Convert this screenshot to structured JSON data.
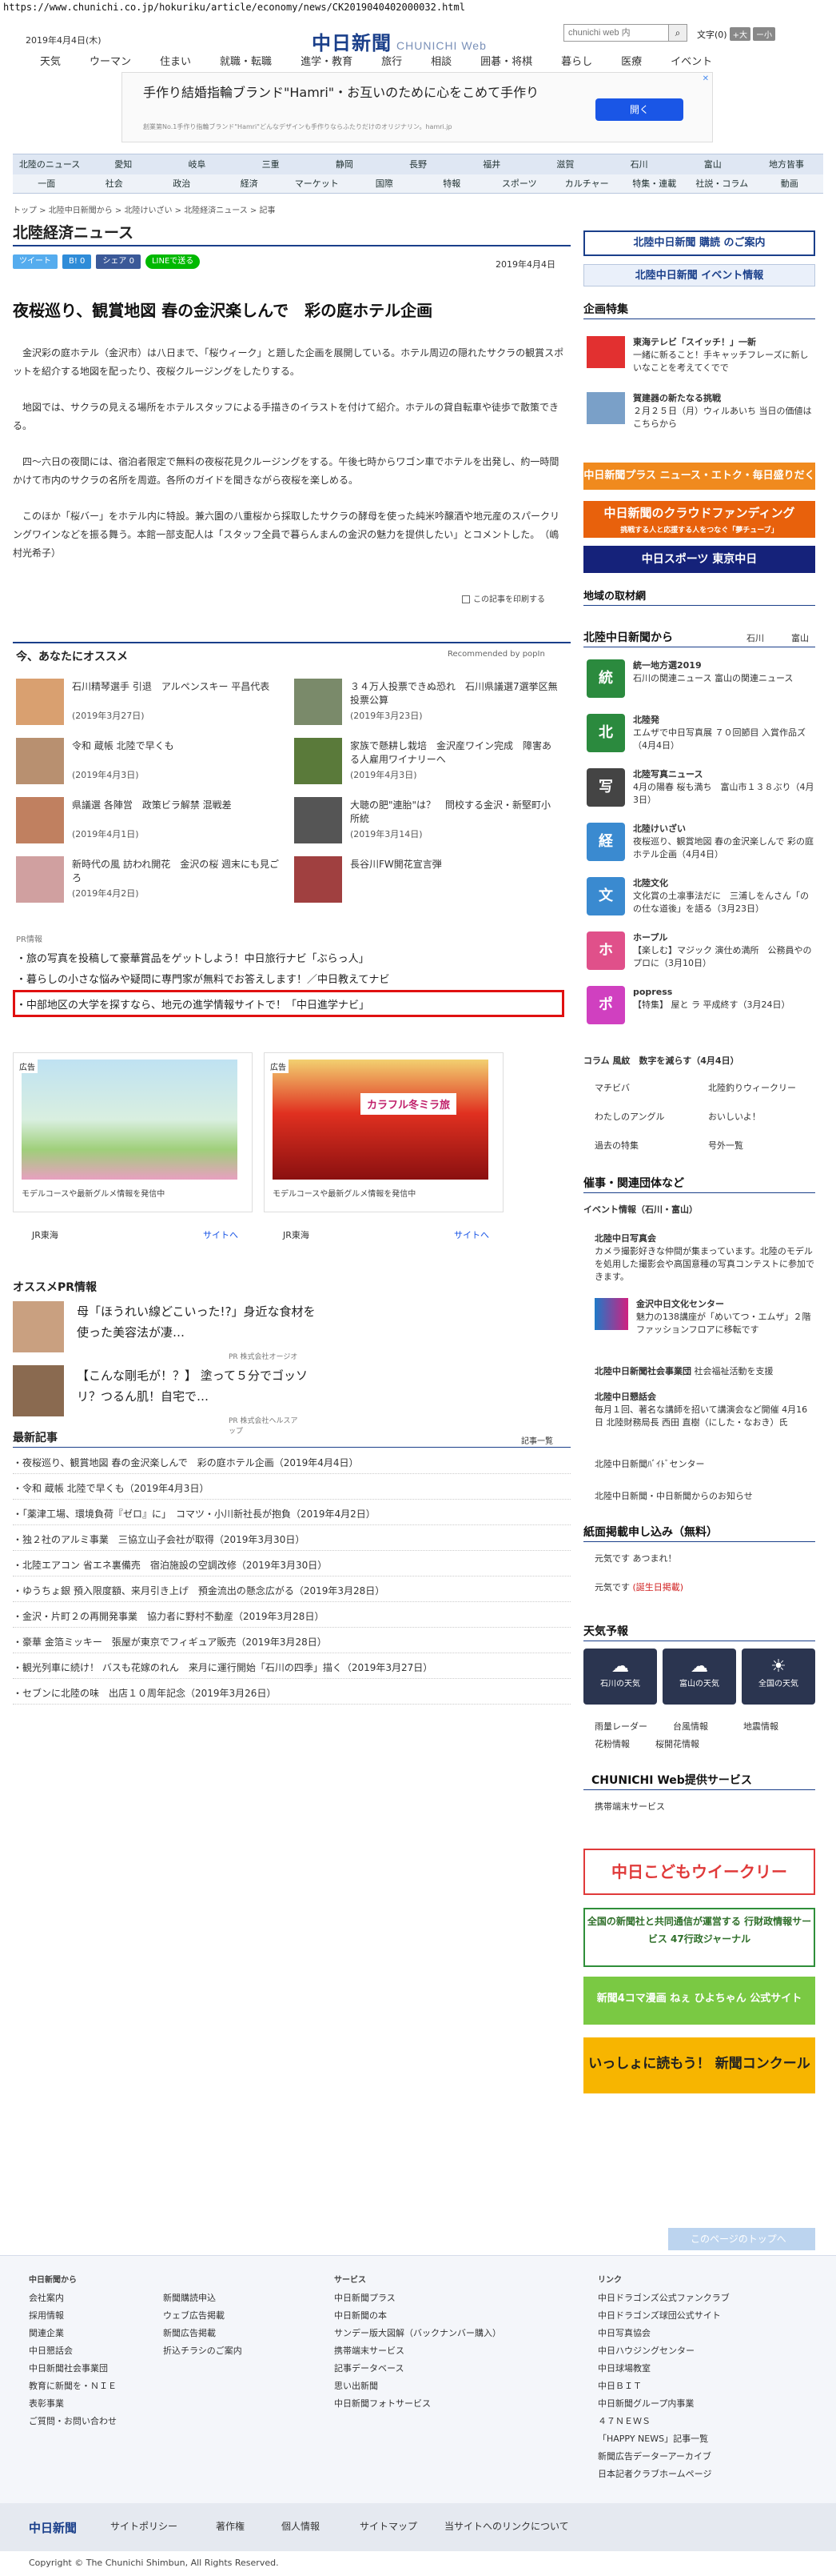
{
  "browser": {
    "url": "https://www.chunichi.co.jp/hokuriku/article/economy/news/CK2019040402000032.html"
  },
  "header": {
    "date": "2019年4月4日(木)",
    "logo": "中日新聞",
    "logo_web": "CHUNICHI Web",
    "search_placeholder": "chunichi web 内",
    "font_label": "文字",
    "font_large": "+大",
    "font_small": "ー小",
    "nav": [
      "天気",
      "ウーマン",
      "住まい",
      "就職・転職",
      "進学・教育",
      "旅行",
      "相談",
      "囲碁・将棋",
      "暮らし",
      "医療",
      "イベント"
    ]
  },
  "ad": {
    "text": "手作り結婚指輪ブランド\"Hamri\"・お互いのために心をこめて手作り",
    "sub": "創業第No.1手作り指輪ブランド\"Hamri\"どんなデザインも手作りならふたりだけのオリジナリン。hamri.jp",
    "button": "開く",
    "close": "✕"
  },
  "nav1": [
    "北陸のニュース",
    "愛知",
    "岐阜",
    "三重",
    "静岡",
    "長野",
    "福井",
    "滋賀",
    "石川",
    "富山",
    "地方皆事"
  ],
  "nav2": [
    "一面",
    "社会",
    "政治",
    "経済",
    "マーケット",
    "国際",
    "特報",
    "スポーツ",
    "カルチャー",
    "特集・連載",
    "社説・コラム",
    "動画"
  ],
  "breadcrumb": "トップ > 北陸中日新聞から > 北陸けいざい > 北陸経済ニュース > 記事",
  "section_title": "北陸経済ニュース",
  "share": {
    "tweet": "ツイート",
    "hatena": "B!  0",
    "facebook": "シェア 0",
    "line": "LINEで送る"
  },
  "article": {
    "date": "2019年4月4日",
    "title": "夜桜巡り、観賞地図 春の金沢楽しんで　彩の庭ホテル企画",
    "paragraphs": [
      "　金沢彩の庭ホテル（金沢市）は八日まで、「桜ウィーク」と題した企画を展開している。ホテル周辺の隠れたサクラの観賞スポットを紹介する地図を配ったり、夜桜クルージングをしたりする。",
      "　地図では、サクラの見える場所をホテルスタッフによる手描きのイラストを付けて紹介。ホテルの貸自転車や徒歩で散策できる。",
      "　四～六日の夜間には、宿泊者限定で無料の夜桜花見クルージングをする。午後七時からワゴン車でホテルを出発し、約一時間かけて市内のサクラの名所を周遊。各所のガイドを聞きながら夜桜を楽しめる。",
      "　このほか「桜バー」をホテル内に特設。兼六園の八重桜から採取したサクラの酵母を使った純米吟醸酒や地元産のスパークリングワインなどを振る舞う。本館一部支配人は「スタッフ全員で暮らんまんの金沢の魅力を提供したい」とコメントした。　（嶋村光希子）"
    ],
    "print": "この記事を印刷する"
  },
  "recommend": {
    "title": "今、あなたにオススメ",
    "by": "Recommended by popIn",
    "items": [
      {
        "title": "石川精琴選手 引退　アルペンスキー 平昌代表",
        "date": "(2019年3月27日)"
      },
      {
        "title": "３４万人投票できぬ恐れ　石川県議選7選挙区無投票公算",
        "date": "(2019年3月23日)"
      },
      {
        "title": "令和 蔵帳 北陸で早くも",
        "date": "(2019年4月3日)"
      },
      {
        "title": "家族で懸耕し栽培　金沢産ワイン完成　障害ある人雇用ワイナリーへ",
        "date": "(2019年4月3日)"
      },
      {
        "title": "県議選 各陣営　政策ビラ解禁 混戦差",
        "date": "(2019年4月1日)"
      },
      {
        "title": "大聴の肥\"連胎\"は？　問校する金沢・新堅町小所統",
        "date": "(2019年3月14日)"
      },
      {
        "title": "新時代の風 訪われ開花　金沢の桜 週末にも見ごろ",
        "date": "(2019年4月2日)"
      },
      {
        "title": "長谷川FW開花宣言弾",
        "date": ""
      }
    ]
  },
  "pr": {
    "label": "PR情報",
    "items": [
      "・旅の写真を投稿して豪華賞品をゲットしよう！中日旅行ナビ「ぶらっ人」",
      "・暮らしの小さな悩みや疑問に専門家が無料でお答えします！／中日教えてナビ",
      "・中部地区の大学を探すなら、地元の進学情報サイトで！「中日進学ナビ」"
    ]
  },
  "adcards": [
    {
      "label": "広告",
      "caption": "モデルコースや最新グルメ情報を発信中",
      "source": "JR東海",
      "link": "サイトへ"
    },
    {
      "label": "広告",
      "caption": "モデルコースや最新グルメ情報を発信中",
      "source": "JR東海",
      "link": "サイトへ",
      "img_text": "カラフル冬ミラ旅"
    }
  ],
  "osusume": {
    "title": "オススメPR情報",
    "items": [
      {
        "title": "母「ほうれい線どこいった!?」身近な食材を使った美容法が凄…",
        "source": "PR 株式会社オージオ"
      },
      {
        "title": "【こんな剛毛が！？】 塗って５分でゴッソリ？つるん肌！自宅で…",
        "source": "PR 株式会社ヘルスアップ"
      }
    ]
  },
  "latest": {
    "title": "最新記事",
    "more": "記事一覧",
    "items": [
      "・夜桜巡り、観賞地図 春の金沢楽しんで　彩の庭ホテル企画（2019年4月4日）",
      "・令和 蔵帳 北陸で早くも（2019年4月3日）",
      "・「薬津工場、環境負荷『ゼロ』に」　コマツ・小川新社長が抱負（2019年4月2日）",
      "・独２社のアルミ事業　三協立山子会社が取得（2019年3月30日）",
      "・北陸エアコン 省エネ裏備売　宿泊施設の空調改修（2019年3月30日）",
      "・ゆうちょ銀 預入限度額、来月引き上げ　預金流出の懸念広がる（2019年3月28日）",
      "・金沢・片町２の再開発事業　協力者に野村不動産（2019年3月28日）",
      "・豪華 金箔ミッキー　張屋が東京でフィギュア販売（2019年3月28日）",
      "・観光列車に続け！ バスも花嫁のれん　来月に運行開始「石川の四季」描く（2019年3月27日）",
      "・セブンに北陸の味　出店１０周年記念（2019年3月26日）"
    ]
  },
  "side": {
    "sub_top": "北陸中日新聞 購読 のご案内",
    "event": "北陸中日新聞 イベント情報",
    "kikaku_title": "企画特集",
    "kikaku": [
      {
        "title": "東海テレビ「スイッチ！」一新",
        "desc": "一緒に新ること！手キャッチフレーズに新しいなことを考えてくでで"
      },
      {
        "title": "賀建器の新たなる挑戦",
        "desc": "２月２５日（月）ウィルあいち 当日の価値はこちらから"
      }
    ],
    "plus": "中日新聞プラス ニュース・エトク・毎日盛りだくさん",
    "cloud": "中日新聞のクラウドファンディング",
    "cloud_sub": "挑戦する人と応援する人をつなぐ「夢チューブ」",
    "tokyo": "中日スポーツ 東京中日",
    "torizai": "地域の取材網",
    "kara_title": "北陸中日新聞から",
    "kara_tabs": [
      "石川",
      "富山"
    ],
    "kara": [
      {
        "icon": "統",
        "title": "統一地方選2019",
        "desc": "石川の関連ニュース 富山の関連ニュース"
      },
      {
        "icon": "北",
        "title": "北陸発",
        "desc": "エムザで中日写真展 ７０回節目 入賞作品ズ（4月4日）"
      },
      {
        "icon": "写",
        "title": "北陸写真ニュース",
        "desc": "4月の陽春 桜も満ち　富山市１３８ぶり（4月3日）"
      },
      {
        "icon": "経",
        "title": "北陸けいざい",
        "desc": "夜桜巡り、観賞地図 春の金沢楽しんで 彩の庭ホテル企画（4月4日）"
      },
      {
        "icon": "文",
        "title": "北陸文化",
        "desc": "文化賞の土凛事法だに　三浦しをんさん「のの仕な道後」を語る（3月23日）"
      },
      {
        "icon": "ホ",
        "title": "ホープル",
        "desc": "【楽しむ】マジック 演仕め満所　公務員やのプロに（3月10日）"
      },
      {
        "icon": "ポ",
        "title": "popress",
        "desc": "【特集】 屋と ラ 平成終す（3月24日）"
      }
    ],
    "column": "コラム 風紋　数字を減らす（4月4日）",
    "links": [
      [
        "マチビバ",
        "北陸釣りウィークリー"
      ],
      [
        "わたしのアングル",
        "おいしいよ！"
      ],
      [
        "過去の特集",
        "号外一覧"
      ]
    ],
    "sponsor_title": "催事・関連団体など",
    "sponsor_event": "イベント情報（石川・富山）",
    "sponsor": [
      {
        "title": "北陸中日写真会",
        "desc": "カメラ撮影好きな仲間が集まっています。北陸のモデルを処用した撮影会や高国意種の写真コンテストに参加できます。"
      },
      {
        "title": "金沢中日文化センター",
        "desc": "魅力の138講座が「めいてつ・エムザ」２階ファッションフロアに移転です"
      },
      {
        "title": "北陸中日新聞社会事業団",
        "desc": "社会福祉活動を支援"
      },
      {
        "title": "北陸中日懇話会",
        "desc": "毎月１回、著名な講師を招いて講演会など開催 4月16日 北陸財務局長 西田 直樹（にした・なおき）氏"
      }
    ],
    "sponsor_links": [
      "北陸中日新聞ﾊﾞｲﾄﾞセンター",
      "北陸中日新聞・中日新聞からのお知らせ"
    ],
    "paper_title": "紙面掲載申し込み（無料）",
    "paper": [
      {
        "label": "元気です あつまれ！",
        "hi": ""
      },
      {
        "label": "元気です",
        "hi": "(誕生日掲載)"
      }
    ],
    "weather_title": "天気予報",
    "weather": [
      "石川の天気",
      "富山の天気",
      "全国の天気"
    ],
    "weather_links": [
      "雨量レーダー",
      "台風情報",
      "地震情報",
      "花粉情報",
      "桜開花情報"
    ],
    "svc_title": "CHUNICHI Web提供サービス",
    "svc": "携帯端末サービス",
    "kodomo": "中日こどもウイークリー",
    "gyosei": "全国の新聞社と共同通信が運営する 行財政情報サービス 47行政ジャーナル",
    "yonkoma": "新聞4コマ漫画 ねぇ ひよちゃん 公式サイト",
    "contest": "いっしょに読もう！ 新聞コンクール",
    "page_top": "このページのトップへ"
  },
  "footer": {
    "col1_title": "中日新聞から",
    "col1": [
      "会社案内",
      "採用情報",
      "関連企業",
      "中日懇話会",
      "中日新聞社会事業団",
      "教育に新聞を・ＮＩＥ",
      "表彰事業",
      "ご質問・お問い合わせ"
    ],
    "col2": [
      "新聞購読申込",
      "ウェブ広告掲載",
      "新聞広告掲載",
      "折込チラシのご案内"
    ],
    "col3_title": "サービス",
    "col3": [
      "中日新聞プラス",
      "中日新聞の本",
      "サンデー版大図解（バックナンバー購入）",
      "携帯端末サービス",
      "記事データベース",
      "思い出新聞",
      "中日新聞フォトサービス"
    ],
    "col4_title": "リンク",
    "col4": [
      "中日ドラゴンズ公式ファンクラブ",
      "中日ドラゴンズ球団公式サイト",
      "中日写真協会",
      "中日ハウジングセンター",
      "中日球場教室",
      "中日ＢＩＴ",
      "中日新聞グループ内事業",
      "４７ＮＥＷＳ",
      "「HAPPY NEWS」記事一覧",
      "新聞広告データーアーカイブ",
      "日本記者クラブホームページ"
    ],
    "bar": [
      "中日新聞",
      "サイトポリシー",
      "著作権",
      "個人情報",
      "サイトマップ",
      "当サイトへのリンクについて"
    ],
    "copyright": "Copyright © The Chunichi Shimbun, All Rights Reserved."
  }
}
